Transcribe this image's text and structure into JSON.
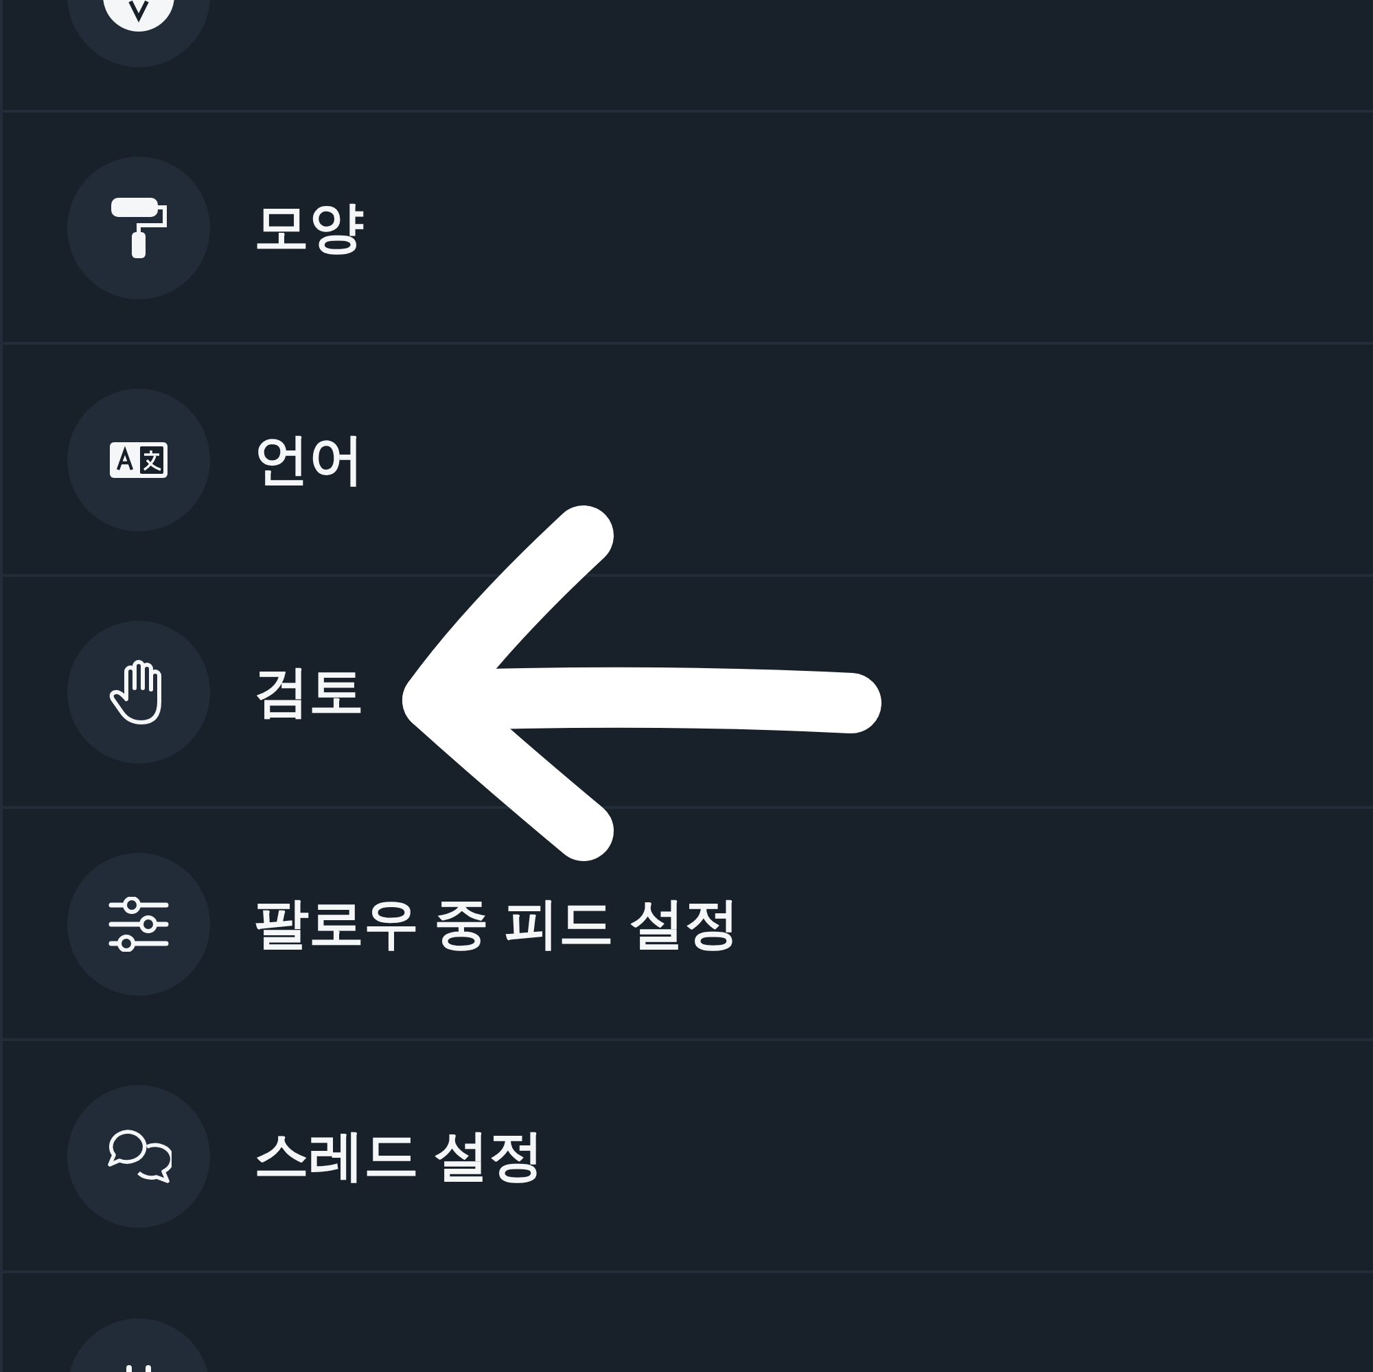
{
  "settings_items": [
    {
      "label": "모양"
    },
    {
      "label": "언어"
    },
    {
      "label": "검토"
    },
    {
      "label": "팔로우 중 피드 설정"
    },
    {
      "label": "스레드 설정"
    }
  ]
}
